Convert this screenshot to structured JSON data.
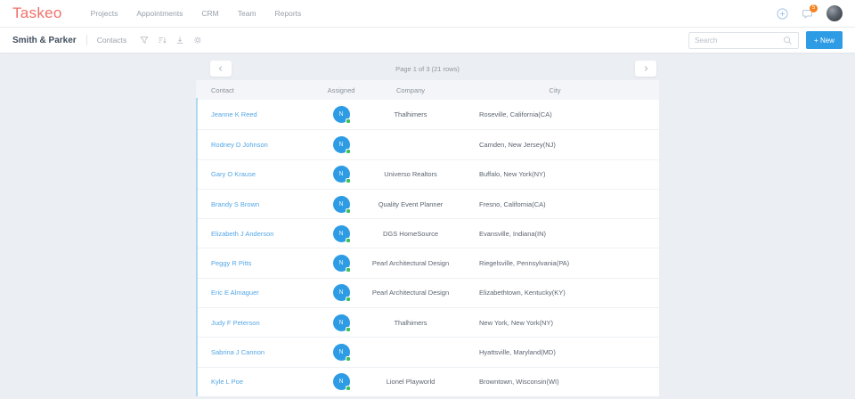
{
  "brand": {
    "logo": "Taskeo"
  },
  "nav": {
    "items": [
      "Projects",
      "Appointments",
      "CRM",
      "Team",
      "Reports"
    ],
    "notification_count": "5"
  },
  "toolbar": {
    "account_name": "Smith & Parker",
    "view_label": "Contacts",
    "search_placeholder": "Search",
    "new_button_label": "+ New"
  },
  "pagination": {
    "label": "Page 1 of 3 (21 rows)"
  },
  "table": {
    "columns": [
      "Contact",
      "Assigned",
      "Company",
      "City"
    ],
    "rows": [
      {
        "contact": "Jeanne K Reed",
        "assigned": "N",
        "company": "Thalhimers",
        "city": "Roseville, California(CA)"
      },
      {
        "contact": "Rodney D Johnson",
        "assigned": "N",
        "company": "",
        "city": "Camden, New Jersey(NJ)"
      },
      {
        "contact": "Gary O Krause",
        "assigned": "N",
        "company": "Universo Realtors",
        "city": "Buffalo, New York(NY)"
      },
      {
        "contact": "Brandy S Brown",
        "assigned": "N",
        "company": "Quality Event Planner",
        "city": "Fresno, California(CA)"
      },
      {
        "contact": "Elizabeth J Anderson",
        "assigned": "N",
        "company": "DGS HomeSource",
        "city": "Evansville, Indiana(IN)"
      },
      {
        "contact": "Peggy R Pitts",
        "assigned": "N",
        "company": "Pearl Architectural Design",
        "city": "Riegelsville, Pennsylvania(PA)"
      },
      {
        "contact": "Eric E Almaguer",
        "assigned": "N",
        "company": "Pearl Architectural Design",
        "city": "Elizabethtown, Kentucky(KY)"
      },
      {
        "contact": "Judy F Peterson",
        "assigned": "N",
        "company": "Thalhimers",
        "city": "New York, New York(NY)"
      },
      {
        "contact": "Sabrina J Cannon",
        "assigned": "N",
        "company": "",
        "city": "Hyattsville, Maryland(MD)"
      },
      {
        "contact": "Kyle L Poe",
        "assigned": "N",
        "company": "Lionel Playworld",
        "city": "Browntown, Wisconsin(WI)"
      }
    ]
  },
  "icons": {
    "plus-circle": "outlined circle with plus",
    "notifications": "chat bubble with count badge",
    "filter": "funnel",
    "sort": "bars with down arrow",
    "download": "arrow into tray",
    "settings": "gear",
    "search": "magnifier",
    "chevron-left": "‹",
    "chevron-right": "›"
  },
  "colors": {
    "brand_red": "#f0706a",
    "accent_blue": "#2e9ce4",
    "link_blue": "#55a7e6",
    "badge_orange": "#f5821f",
    "online_green": "#3ec05e",
    "page_bg": "#ebeef2",
    "header_bg": "#f3f5f8",
    "accent_border": "#aedaf1"
  }
}
